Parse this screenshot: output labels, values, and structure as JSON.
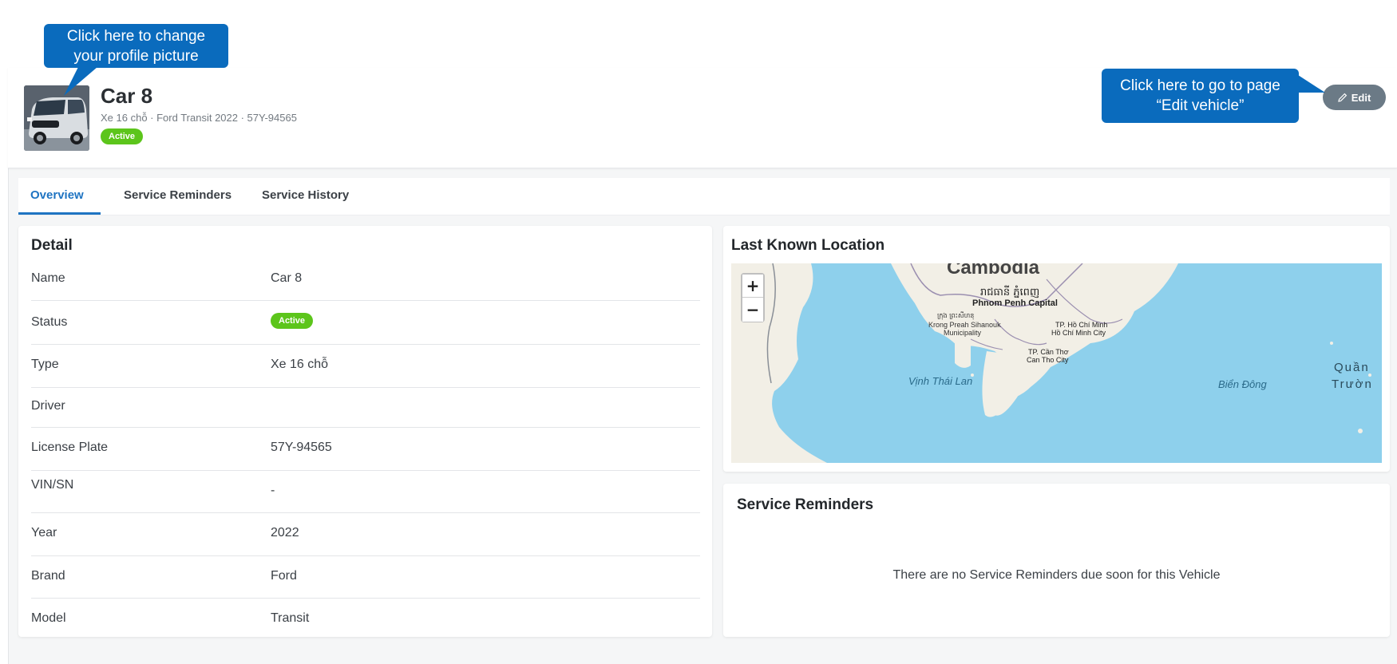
{
  "callouts": {
    "profile_line1": "Click here to change",
    "profile_line2": "your profile picture",
    "edit_line1": "Click here to go to page",
    "edit_line2": "“Edit vehicle”"
  },
  "vehicle": {
    "name": "Car 8",
    "subtitle": "Xe 16 chỗ · Ford Transit 2022 · 57Y-94565",
    "status": "Active",
    "photo_icon": "van-photo"
  },
  "header": {
    "edit_label": "Edit",
    "edit_icon": "pencil-icon"
  },
  "tabs": [
    {
      "label": "Overview",
      "active": true
    },
    {
      "label": "Service Reminders",
      "active": false
    },
    {
      "label": "Service History",
      "active": false
    }
  ],
  "detail": {
    "title": "Detail",
    "rows": [
      {
        "label": "Name",
        "value": "Car 8"
      },
      {
        "label": "Status",
        "value": "Active"
      },
      {
        "label": "Type",
        "value": "Xe 16 chỗ"
      },
      {
        "label": "Driver",
        "value": ""
      },
      {
        "label": "License Plate",
        "value": "57Y-94565"
      },
      {
        "label": "VIN/SN",
        "value": "-"
      },
      {
        "label": "Year",
        "value": "2022"
      },
      {
        "label": "Brand",
        "value": "Ford"
      },
      {
        "label": "Model",
        "value": "Transit"
      }
    ]
  },
  "location": {
    "title": "Last Known Location",
    "zoom_in": "+",
    "zoom_out": "−",
    "map_labels": {
      "country": "Cambodia",
      "capital_khmer": "រាជធានី ភ្នំពេញ",
      "capital": "Phnom Penh Capital",
      "sihanouk_khmer": "ក្រុង ព្រះសីហនុ",
      "sihanouk_1": "Krong Preah Sihanouk",
      "sihanouk_2": "Municipality",
      "hcm_1": "TP. Hồ Chí Minh",
      "hcm_2": "Hồ Chí Minh City",
      "cantho_1": "TP. Cần Thơ",
      "cantho_2": "Can Tho City",
      "gulf": "Vịnh Thái Lan",
      "sea": "Biển Đông",
      "quan": "Quần",
      "truong": "Trườn"
    },
    "colors": {
      "water": "#8ed0ec",
      "land": "#f2efe6"
    }
  },
  "reminders": {
    "title": "Service Reminders",
    "empty_text": "There are no Service Reminders due soon for this Vehicle"
  },
  "colors": {
    "accent": "#1f74c2",
    "status_active": "#5cc51b",
    "callout": "#0a6bbd",
    "edit_button": "#6b7a86"
  }
}
